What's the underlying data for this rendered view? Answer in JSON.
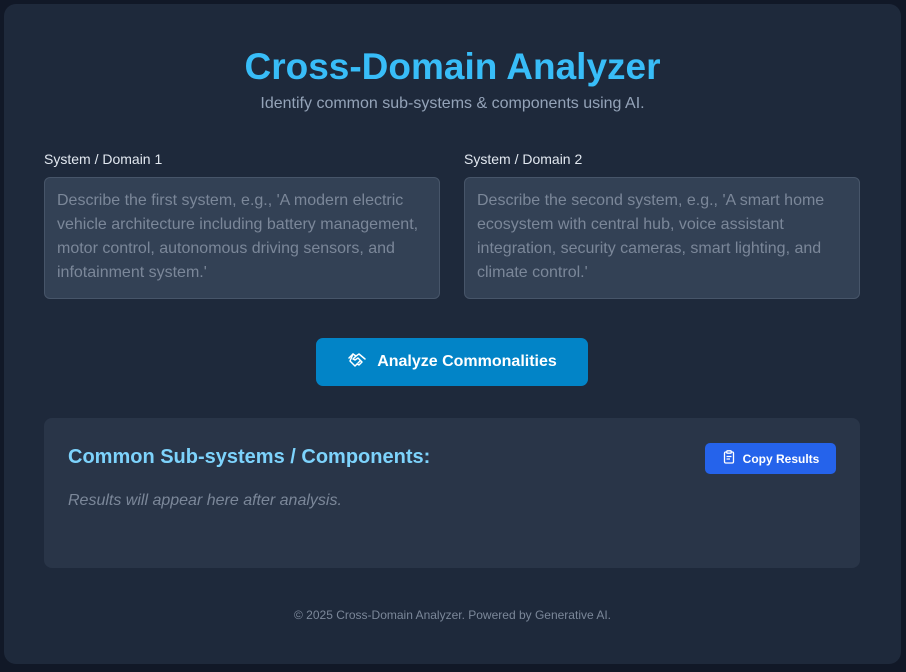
{
  "header": {
    "title": "Cross-Domain Analyzer",
    "subtitle": "Identify common sub-systems & components using AI."
  },
  "domain1": {
    "label": "System / Domain 1",
    "value": "",
    "placeholder": "Describe the first system, e.g., 'A modern electric vehicle architecture including battery management, motor control, autonomous driving sensors, and infotainment system.'"
  },
  "domain2": {
    "label": "System / Domain 2",
    "value": "",
    "placeholder": "Describe the second system, e.g., 'A smart home ecosystem with central hub, voice assistant integration, security cameras, smart lighting, and climate control.'"
  },
  "analyze_button": {
    "label": "Analyze Commonalities",
    "icon": "handshake-icon"
  },
  "results": {
    "title": "Common Sub-systems / Components:",
    "copy_label": "Copy Results",
    "copy_icon": "clipboard-icon",
    "placeholder": "Results will appear here after analysis."
  },
  "footer": {
    "text": "© 2025 Cross-Domain Analyzer. Powered by Generative AI."
  },
  "colors": {
    "background": "#111827",
    "card": "#1e293b",
    "title": "#38bdf8",
    "analyze_button": "#0284c7",
    "copy_button": "#2563eb",
    "results_title": "#7dd3fc"
  }
}
